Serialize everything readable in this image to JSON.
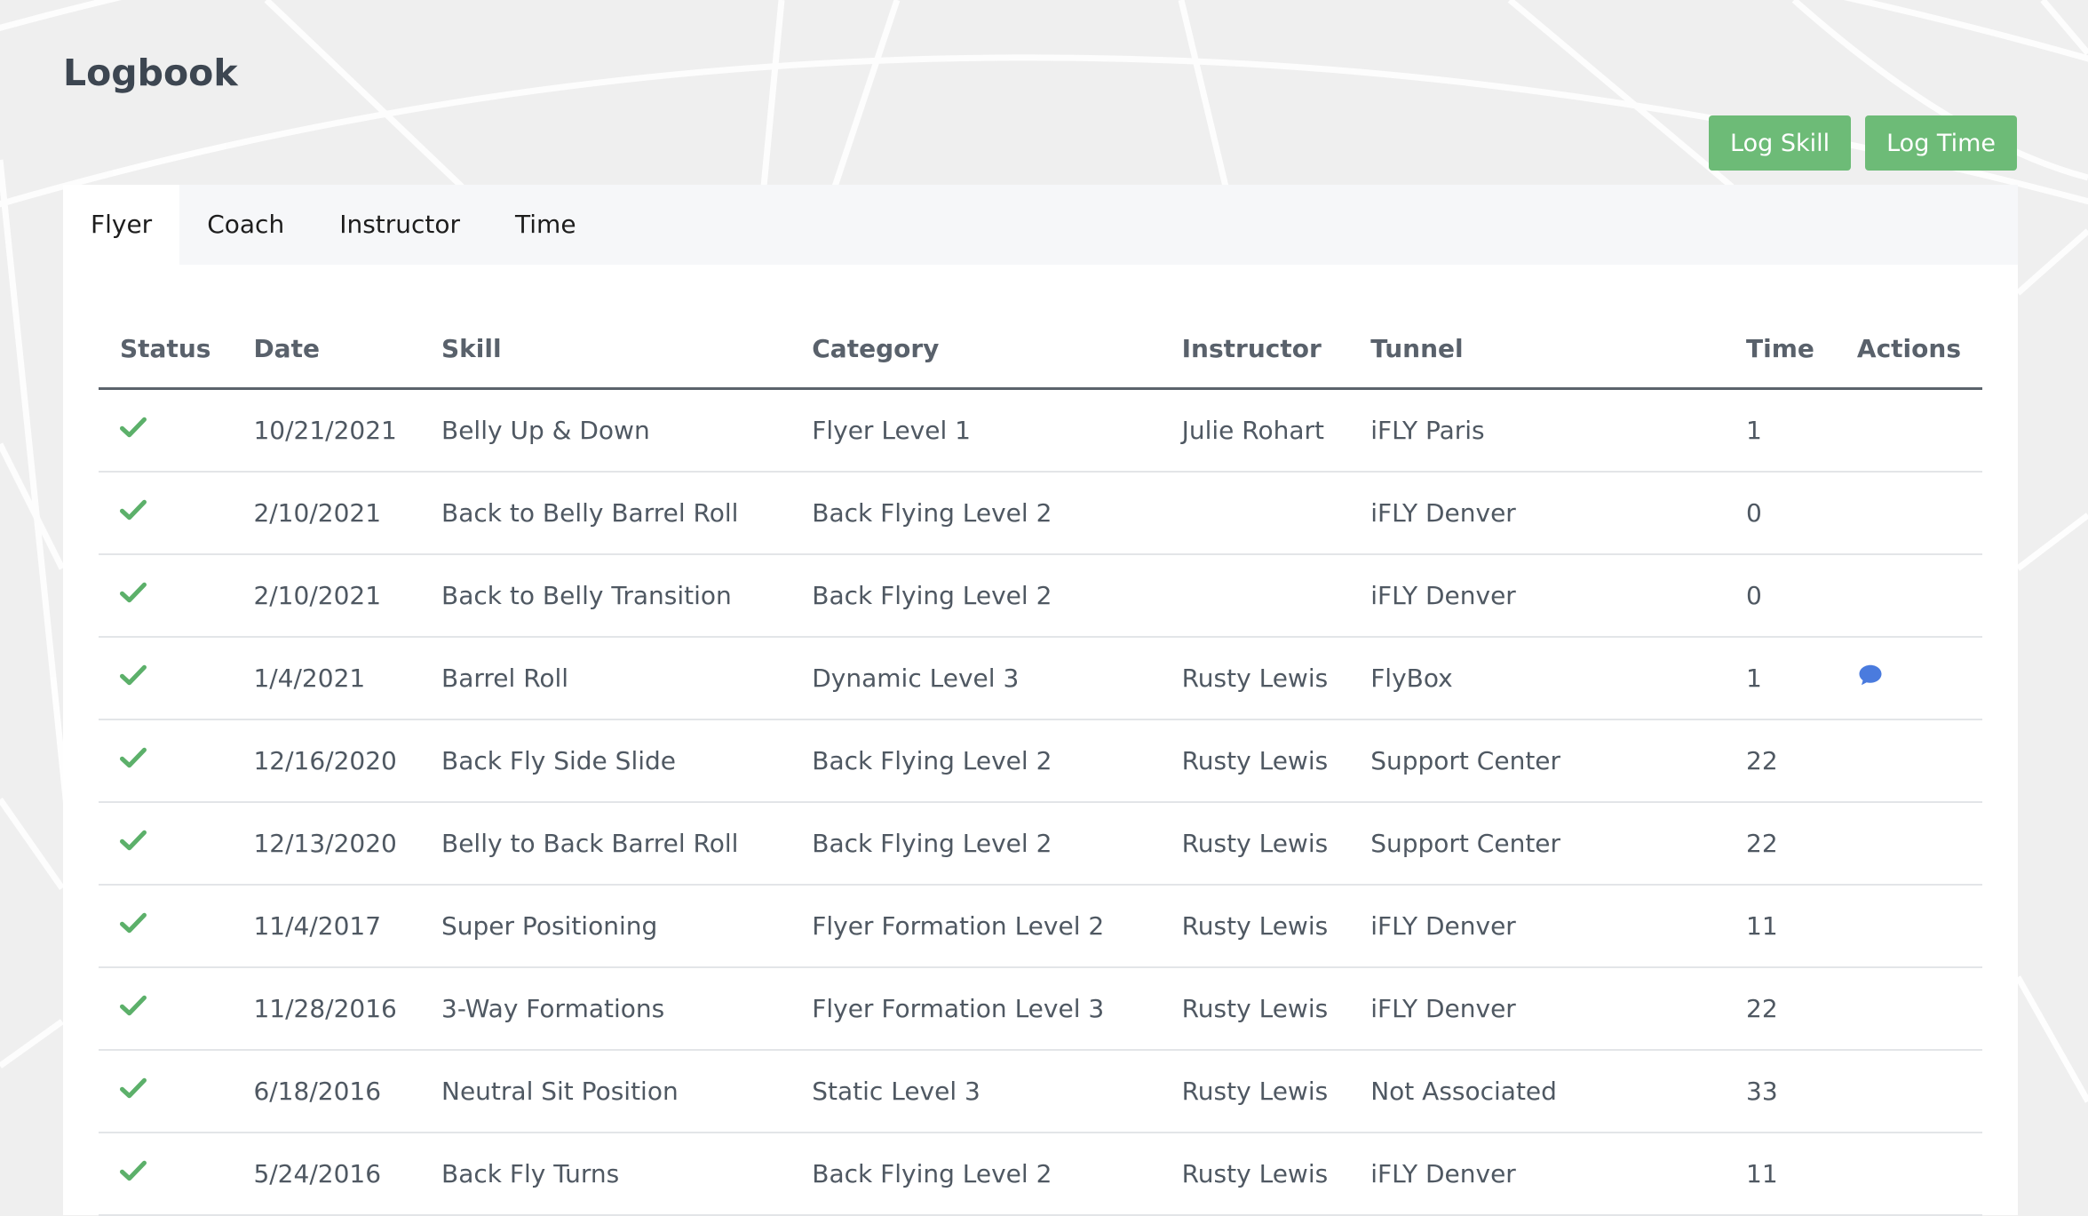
{
  "page": {
    "title": "Logbook"
  },
  "toolbar": {
    "log_skill_label": "Log Skill",
    "log_time_label": "Log Time",
    "button_color": "#6dbb77"
  },
  "tabs": [
    {
      "label": "Flyer",
      "active": true
    },
    {
      "label": "Coach",
      "active": false
    },
    {
      "label": "Instructor",
      "active": false
    },
    {
      "label": "Time",
      "active": false
    }
  ],
  "table": {
    "columns": [
      "Status",
      "Date",
      "Skill",
      "Category",
      "Instructor",
      "Tunnel",
      "Time",
      "Actions"
    ],
    "status_icon": "check-icon",
    "status_color": "#5cb06a",
    "action_icon": "comment-icon",
    "action_color": "#4a7bde",
    "rows": [
      {
        "status": "complete",
        "date": "10/21/2021",
        "skill": "Belly Up & Down",
        "category": "Flyer Level 1",
        "instructor": "Julie Rohart",
        "tunnel": "iFLY Paris",
        "time": "1",
        "has_comment": false
      },
      {
        "status": "complete",
        "date": "2/10/2021",
        "skill": "Back to Belly Barrel Roll",
        "category": "Back Flying Level 2",
        "instructor": "",
        "tunnel": "iFLY Denver",
        "time": "0",
        "has_comment": false
      },
      {
        "status": "complete",
        "date": "2/10/2021",
        "skill": "Back to Belly Transition",
        "category": "Back Flying Level 2",
        "instructor": "",
        "tunnel": "iFLY Denver",
        "time": "0",
        "has_comment": false
      },
      {
        "status": "complete",
        "date": "1/4/2021",
        "skill": "Barrel Roll",
        "category": "Dynamic Level 3",
        "instructor": "Rusty Lewis",
        "tunnel": "FlyBox",
        "time": "1",
        "has_comment": true
      },
      {
        "status": "complete",
        "date": "12/16/2020",
        "skill": "Back Fly Side Slide",
        "category": "Back Flying Level 2",
        "instructor": "Rusty Lewis",
        "tunnel": "Support Center",
        "time": "22",
        "has_comment": false
      },
      {
        "status": "complete",
        "date": "12/13/2020",
        "skill": "Belly to Back Barrel Roll",
        "category": "Back Flying Level 2",
        "instructor": "Rusty Lewis",
        "tunnel": "Support Center",
        "time": "22",
        "has_comment": false
      },
      {
        "status": "complete",
        "date": "11/4/2017",
        "skill": "Super Positioning",
        "category": "Flyer Formation Level 2",
        "instructor": "Rusty Lewis",
        "tunnel": "iFLY Denver",
        "time": "11",
        "has_comment": false
      },
      {
        "status": "complete",
        "date": "11/28/2016",
        "skill": "3-Way Formations",
        "category": "Flyer Formation Level 3",
        "instructor": "Rusty Lewis",
        "tunnel": "iFLY Denver",
        "time": "22",
        "has_comment": false
      },
      {
        "status": "complete",
        "date": "6/18/2016",
        "skill": "Neutral Sit Position",
        "category": "Static Level 3",
        "instructor": "Rusty Lewis",
        "tunnel": "Not Associated",
        "time": "33",
        "has_comment": false
      },
      {
        "status": "complete",
        "date": "5/24/2016",
        "skill": "Back Fly Turns",
        "category": "Back Flying Level 2",
        "instructor": "Rusty Lewis",
        "tunnel": "iFLY Denver",
        "time": "11",
        "has_comment": false
      }
    ]
  }
}
